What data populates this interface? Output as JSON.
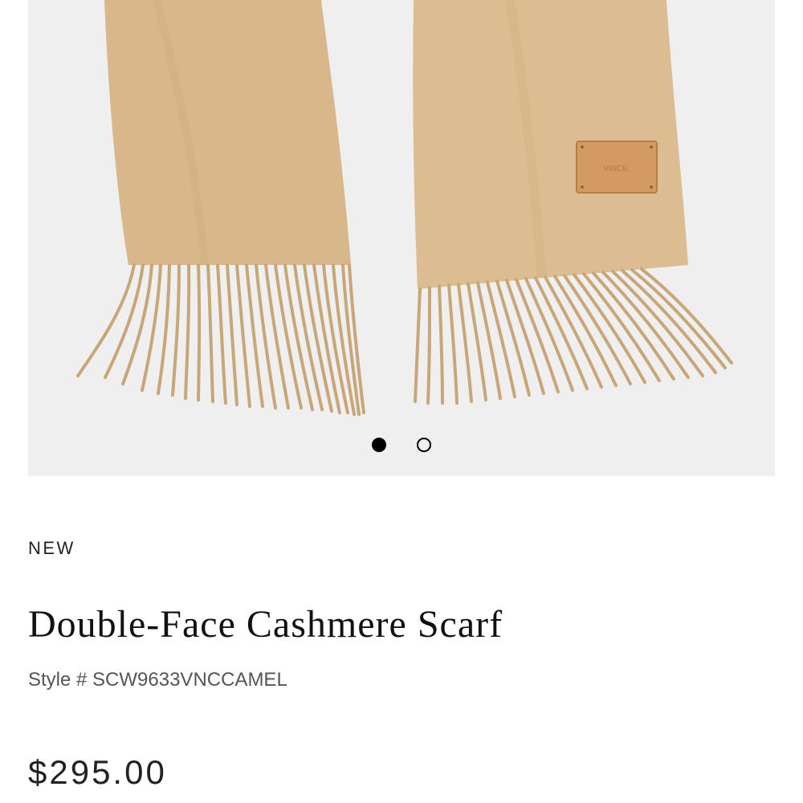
{
  "gallery": {
    "label_on_patch": "VINCE.",
    "slides": [
      {
        "state": "active"
      },
      {
        "state": "inactive"
      }
    ]
  },
  "product": {
    "badge": "NEW",
    "name": "Double-Face Cashmere Scarf",
    "style_label": "Style #",
    "style_number": "SCW9633VNCCAMEL",
    "price": "$295.00"
  },
  "colors": {
    "background": "#ffffff",
    "gallery_bg": "#efefef",
    "scarf": "#d8b88b",
    "fringe": "#c9a677",
    "patch": "#d39a62",
    "text_primary": "#111111",
    "text_secondary": "#555555"
  }
}
